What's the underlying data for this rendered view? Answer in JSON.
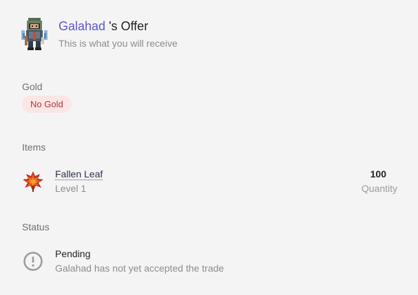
{
  "header": {
    "trader_name": "Galahad",
    "title_suffix": " 's Offer",
    "subtitle": "This is what you will receive",
    "avatar_icon": "knight-avatar-icon"
  },
  "gold": {
    "label": "Gold",
    "badge": "No Gold"
  },
  "items": {
    "label": "Items",
    "list": [
      {
        "name": "Fallen Leaf",
        "level": "Level 1",
        "quantity": "100",
        "quantity_label": "Quantity",
        "icon": "fallen-leaf-icon"
      }
    ]
  },
  "status": {
    "label": "Status",
    "title": "Pending",
    "description": "Galahad has not yet accepted the trade",
    "icon": "alert-circle-icon"
  },
  "colors": {
    "accent": "#5b55d6",
    "badge_bg": "#fbe5e5",
    "badge_text": "#b0373c"
  }
}
